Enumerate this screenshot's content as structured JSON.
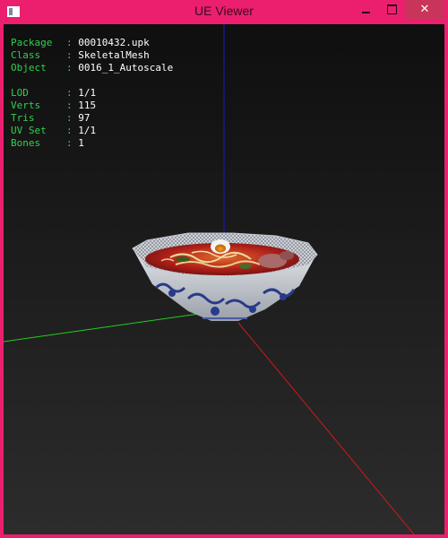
{
  "window": {
    "title": "UE Viewer",
    "icon": "app-icon",
    "controls": [
      "minimize-icon",
      "maximize-icon",
      "close-icon"
    ],
    "close_glyph": "✕"
  },
  "info": {
    "object_info": [
      {
        "key": "Package",
        "sep": ":",
        "value": "00010432.upk"
      },
      {
        "key": "Class  ",
        "sep": ":",
        "value": "SkeletalMesh"
      },
      {
        "key": "Object ",
        "sep": ":",
        "value": "0016_1_Autoscale"
      }
    ],
    "mesh_stats": [
      {
        "key": "LOD    ",
        "sep": ":",
        "value": "1/1"
      },
      {
        "key": "Verts  ",
        "sep": ":",
        "value": "115"
      },
      {
        "key": "Tris   ",
        "sep": ":",
        "value": "97"
      },
      {
        "key": "UV Set ",
        "sep": ":",
        "value": "1/1"
      },
      {
        "key": "Bones  ",
        "sep": ":",
        "value": "1"
      }
    ]
  },
  "colors": {
    "window_frame": "#ec1f6e",
    "label_green": "#30d050",
    "axis_x": "#d01818",
    "axis_y": "#22cc22",
    "axis_z": "#1a1acc"
  }
}
